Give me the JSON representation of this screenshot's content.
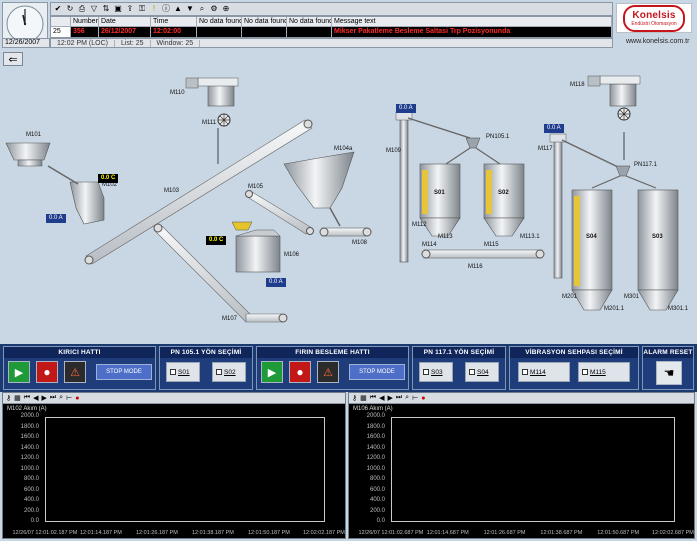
{
  "header": {
    "toolbar_icons": [
      "alarm-ack-icon",
      "refresh-icon",
      "print-icon",
      "filter-icon",
      "sort-icon",
      "save-icon",
      "export-icon",
      "lock-icon",
      "warning-icon",
      "info-icon",
      "up-icon",
      "down-icon",
      "search-icon",
      "settings-icon",
      "zoom-icon"
    ],
    "table_columns": [
      "",
      "Number",
      "Date",
      "Time",
      "No data found",
      "No data found",
      "No data found",
      "Message text"
    ],
    "alarm_row": {
      "index": "25",
      "number": "356",
      "date": "26/12/2007",
      "time": "12:02:00",
      "no_data_1": "",
      "no_data_2": "",
      "no_data_3": "",
      "message": "Mikser Pakatleme Besleme Saltasi Trp Pozisyonunda"
    },
    "status": {
      "date": "12/26/2007",
      "time": "12:02 PM (LOC)",
      "list": "List: 25",
      "window": "Window: 25"
    },
    "logo": {
      "name": "Konelsis",
      "tagline": "Endüstri Otomasyon",
      "url": "www.konelsis.com.tr"
    }
  },
  "mimic": {
    "tags": {
      "m101": "M101",
      "m102": "M102",
      "m103": "M103",
      "m104a": "M104a",
      "m105": "M105",
      "m106": "M106",
      "m107": "M107",
      "m108": "M108",
      "m109": "M109",
      "m110": "M110",
      "m111": "M111",
      "m112": "M112",
      "m113": "M113",
      "m113_1": "M113.1",
      "m114": "M114",
      "m114b": "M114",
      "m115": "M115",
      "m116": "M116",
      "m117": "M117",
      "m118": "M118",
      "m201": "M201",
      "m201_1": "M201.1",
      "m301": "M301",
      "m301_1": "M301.1",
      "pn105": "PN105.1",
      "pn117": "PN117.1",
      "s01": "S01",
      "s02": "S02",
      "s03": "S03",
      "s04": "S04"
    },
    "readings": {
      "m102_temp": "0.0 C",
      "m102_current": "0.0 A",
      "m109_temp": "0.0 C",
      "m106_current": "0.0 A",
      "m113_current": "0.0 A",
      "m117_current": "0.0 A"
    }
  },
  "controls": {
    "kirici": {
      "title": "KIRICI HATTI",
      "mode": "STOP MODE"
    },
    "pn105": {
      "title": "PN 105.1 YÖN SEÇİMİ",
      "opt1": "S01",
      "opt2": "S02"
    },
    "firin": {
      "title": "FIRIN BESLEME HATTI",
      "mode": "STOP MODE"
    },
    "pn117": {
      "title": "PN 117.1 YÖN SEÇİMİ",
      "opt1": "S03",
      "opt2": "S04"
    },
    "vibrasyon": {
      "title": "VİBRASYON SEHPASI SEÇİMİ",
      "opt1": "M114",
      "opt2": "M115"
    },
    "alarm_reset": {
      "title": "ALARM RESET"
    }
  },
  "trends": [
    {
      "title": "M102 Akım (A)",
      "y_ticks": [
        "2000.0",
        "1800.0",
        "1600.0",
        "1400.0",
        "1200.0",
        "1000.0",
        "800.0",
        "600.0",
        "400.0",
        "200.0",
        "0.0"
      ],
      "x_ticks": [
        "12/26/07 12:01:02.187 PM",
        "12:01:14.187 PM",
        "12:01:26.187 PM",
        "12:01:38.187 PM",
        "12:01:50.187 PM",
        "12:02:02.187 PM"
      ]
    },
    {
      "title": "M106 Akım (A)",
      "y_ticks": [
        "2000.0",
        "1800.0",
        "1600.0",
        "1400.0",
        "1200.0",
        "1000.0",
        "800.0",
        "600.0",
        "400.0",
        "200.0",
        "0.0"
      ],
      "x_ticks": [
        "12/26/07 12:01:02.687 PM",
        "12:01:14.687 PM",
        "12:01:26.687 PM",
        "12:01:38.687 PM",
        "12:01:50.687 PM",
        "12:02:02.687 PM"
      ]
    }
  ],
  "colors": {
    "background": "#c9d6e3",
    "alarm_text": "#ff2a2a",
    "panel": "#1f3d7a",
    "start": "#1e9a38",
    "stop": "#c31818",
    "logo": "#c4161c"
  }
}
